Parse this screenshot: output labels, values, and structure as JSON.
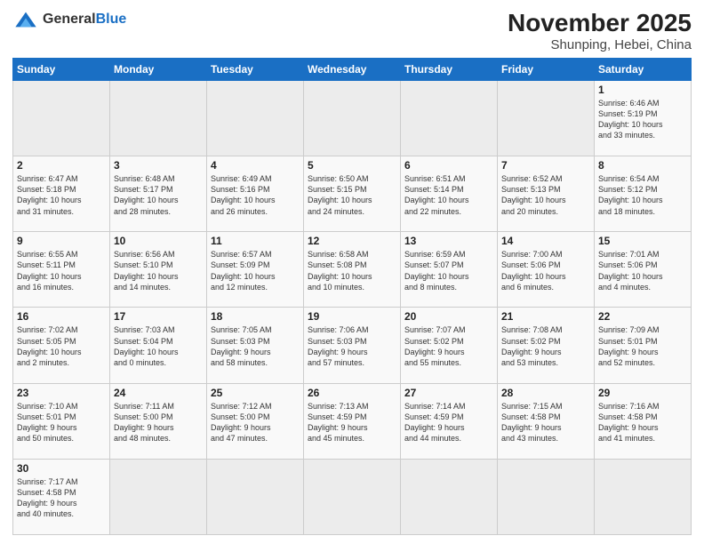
{
  "header": {
    "logo_general": "General",
    "logo_blue": "Blue",
    "title": "November 2025",
    "subtitle": "Shunping, Hebei, China"
  },
  "weekdays": [
    "Sunday",
    "Monday",
    "Tuesday",
    "Wednesday",
    "Thursday",
    "Friday",
    "Saturday"
  ],
  "weeks": [
    [
      {
        "day": "",
        "info": ""
      },
      {
        "day": "",
        "info": ""
      },
      {
        "day": "",
        "info": ""
      },
      {
        "day": "",
        "info": ""
      },
      {
        "day": "",
        "info": ""
      },
      {
        "day": "",
        "info": ""
      },
      {
        "day": "1",
        "info": "Sunrise: 6:46 AM\nSunset: 5:19 PM\nDaylight: 10 hours\nand 33 minutes."
      }
    ],
    [
      {
        "day": "2",
        "info": "Sunrise: 6:47 AM\nSunset: 5:18 PM\nDaylight: 10 hours\nand 31 minutes."
      },
      {
        "day": "3",
        "info": "Sunrise: 6:48 AM\nSunset: 5:17 PM\nDaylight: 10 hours\nand 28 minutes."
      },
      {
        "day": "4",
        "info": "Sunrise: 6:49 AM\nSunset: 5:16 PM\nDaylight: 10 hours\nand 26 minutes."
      },
      {
        "day": "5",
        "info": "Sunrise: 6:50 AM\nSunset: 5:15 PM\nDaylight: 10 hours\nand 24 minutes."
      },
      {
        "day": "6",
        "info": "Sunrise: 6:51 AM\nSunset: 5:14 PM\nDaylight: 10 hours\nand 22 minutes."
      },
      {
        "day": "7",
        "info": "Sunrise: 6:52 AM\nSunset: 5:13 PM\nDaylight: 10 hours\nand 20 minutes."
      },
      {
        "day": "8",
        "info": "Sunrise: 6:54 AM\nSunset: 5:12 PM\nDaylight: 10 hours\nand 18 minutes."
      }
    ],
    [
      {
        "day": "9",
        "info": "Sunrise: 6:55 AM\nSunset: 5:11 PM\nDaylight: 10 hours\nand 16 minutes."
      },
      {
        "day": "10",
        "info": "Sunrise: 6:56 AM\nSunset: 5:10 PM\nDaylight: 10 hours\nand 14 minutes."
      },
      {
        "day": "11",
        "info": "Sunrise: 6:57 AM\nSunset: 5:09 PM\nDaylight: 10 hours\nand 12 minutes."
      },
      {
        "day": "12",
        "info": "Sunrise: 6:58 AM\nSunset: 5:08 PM\nDaylight: 10 hours\nand 10 minutes."
      },
      {
        "day": "13",
        "info": "Sunrise: 6:59 AM\nSunset: 5:07 PM\nDaylight: 10 hours\nand 8 minutes."
      },
      {
        "day": "14",
        "info": "Sunrise: 7:00 AM\nSunset: 5:06 PM\nDaylight: 10 hours\nand 6 minutes."
      },
      {
        "day": "15",
        "info": "Sunrise: 7:01 AM\nSunset: 5:06 PM\nDaylight: 10 hours\nand 4 minutes."
      }
    ],
    [
      {
        "day": "16",
        "info": "Sunrise: 7:02 AM\nSunset: 5:05 PM\nDaylight: 10 hours\nand 2 minutes."
      },
      {
        "day": "17",
        "info": "Sunrise: 7:03 AM\nSunset: 5:04 PM\nDaylight: 10 hours\nand 0 minutes."
      },
      {
        "day": "18",
        "info": "Sunrise: 7:05 AM\nSunset: 5:03 PM\nDaylight: 9 hours\nand 58 minutes."
      },
      {
        "day": "19",
        "info": "Sunrise: 7:06 AM\nSunset: 5:03 PM\nDaylight: 9 hours\nand 57 minutes."
      },
      {
        "day": "20",
        "info": "Sunrise: 7:07 AM\nSunset: 5:02 PM\nDaylight: 9 hours\nand 55 minutes."
      },
      {
        "day": "21",
        "info": "Sunrise: 7:08 AM\nSunset: 5:02 PM\nDaylight: 9 hours\nand 53 minutes."
      },
      {
        "day": "22",
        "info": "Sunrise: 7:09 AM\nSunset: 5:01 PM\nDaylight: 9 hours\nand 52 minutes."
      }
    ],
    [
      {
        "day": "23",
        "info": "Sunrise: 7:10 AM\nSunset: 5:01 PM\nDaylight: 9 hours\nand 50 minutes."
      },
      {
        "day": "24",
        "info": "Sunrise: 7:11 AM\nSunset: 5:00 PM\nDaylight: 9 hours\nand 48 minutes."
      },
      {
        "day": "25",
        "info": "Sunrise: 7:12 AM\nSunset: 5:00 PM\nDaylight: 9 hours\nand 47 minutes."
      },
      {
        "day": "26",
        "info": "Sunrise: 7:13 AM\nSunset: 4:59 PM\nDaylight: 9 hours\nand 45 minutes."
      },
      {
        "day": "27",
        "info": "Sunrise: 7:14 AM\nSunset: 4:59 PM\nDaylight: 9 hours\nand 44 minutes."
      },
      {
        "day": "28",
        "info": "Sunrise: 7:15 AM\nSunset: 4:58 PM\nDaylight: 9 hours\nand 43 minutes."
      },
      {
        "day": "29",
        "info": "Sunrise: 7:16 AM\nSunset: 4:58 PM\nDaylight: 9 hours\nand 41 minutes."
      }
    ],
    [
      {
        "day": "30",
        "info": "Sunrise: 7:17 AM\nSunset: 4:58 PM\nDaylight: 9 hours\nand 40 minutes."
      },
      {
        "day": "",
        "info": ""
      },
      {
        "day": "",
        "info": ""
      },
      {
        "day": "",
        "info": ""
      },
      {
        "day": "",
        "info": ""
      },
      {
        "day": "",
        "info": ""
      },
      {
        "day": "",
        "info": ""
      }
    ]
  ]
}
